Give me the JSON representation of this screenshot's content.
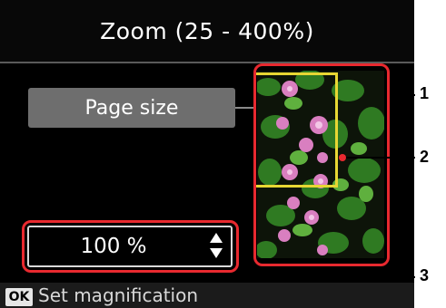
{
  "screen": {
    "title": "Zoom (25 - 400%)",
    "page_size_button": "Page size",
    "magnification": {
      "value": "100 %",
      "control_icon": "up-down-arrows-icon"
    },
    "preview": {
      "image": "photo of pink flowers with green leaves",
      "crop_box_color": "#e7d733"
    },
    "footer": {
      "ok_key": "OK",
      "hint": "Set magnification"
    }
  },
  "callouts": [
    "1",
    "2",
    "3"
  ],
  "colors": {
    "highlight_frame": "#e8292f",
    "crop_box": "#e7d733",
    "button_gray": "#6e6e6e",
    "screen_bg": "#000000"
  }
}
